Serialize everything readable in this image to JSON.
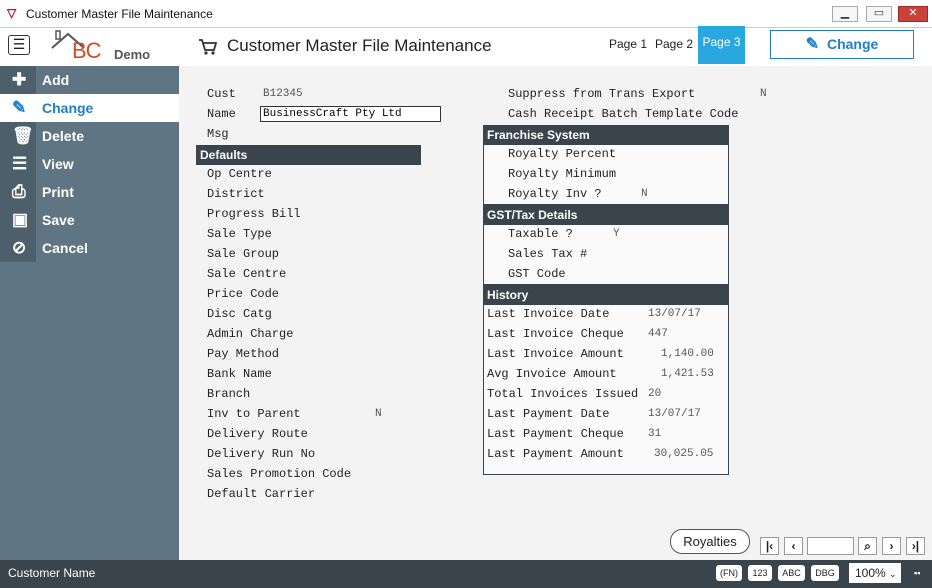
{
  "window": {
    "title": "Customer Master File Maintenance"
  },
  "header": {
    "logo_text": "BC",
    "logo_demo": "Demo",
    "page_title": "Customer Master File Maintenance",
    "tabs": [
      "Page 1",
      "Page 2",
      "Page 3"
    ],
    "active_tab": "Page 3",
    "mode_button": "Change"
  },
  "sidebar": {
    "items": [
      {
        "label": "Add",
        "icon": "plus-icon"
      },
      {
        "label": "Change",
        "icon": "pencil-icon"
      },
      {
        "label": "Delete",
        "icon": "trash-icon"
      },
      {
        "label": "View",
        "icon": "list-icon"
      },
      {
        "label": "Print",
        "icon": "printer-icon"
      },
      {
        "label": "Save",
        "icon": "floppy-icon"
      },
      {
        "label": "Cancel",
        "icon": "cancel-icon"
      }
    ],
    "active": "Change"
  },
  "form": {
    "cust_label": "Cust",
    "cust_value": "B12345",
    "name_label": "Name",
    "name_value": "BusinessCraft Pty Ltd",
    "msg_label": "Msg",
    "defaults_title": "Defaults",
    "defaults": [
      {
        "label": "Op Centre",
        "value": ""
      },
      {
        "label": "District",
        "value": ""
      },
      {
        "label": "Progress Bill",
        "value": ""
      },
      {
        "label": "Sale Type",
        "value": ""
      },
      {
        "label": "Sale Group",
        "value": ""
      },
      {
        "label": "Sale Centre",
        "value": ""
      },
      {
        "label": "Price Code",
        "value": ""
      },
      {
        "label": "Disc Catg",
        "value": ""
      },
      {
        "label": "Admin Charge",
        "value": ""
      },
      {
        "label": "Pay Method",
        "value": ""
      },
      {
        "label": "Bank Name",
        "value": ""
      },
      {
        "label": "Branch",
        "value": ""
      },
      {
        "label": "Inv to Parent",
        "value": "N"
      },
      {
        "label": "Delivery Route",
        "value": ""
      },
      {
        "label": "Delivery Run No",
        "value": ""
      },
      {
        "label": "Sales Promotion Code",
        "value": ""
      },
      {
        "label": "Default Carrier",
        "value": ""
      }
    ],
    "suppress_label": "Suppress from Trans Export",
    "suppress_value": "N",
    "cash_receipt_label": "Cash Receipt Batch Template Code",
    "franchise_title": "Franchise System",
    "franchise": [
      {
        "label": "Royalty Percent",
        "value": ""
      },
      {
        "label": "Royalty Minimum",
        "value": ""
      },
      {
        "label": "Royalty Inv ?",
        "value": "N"
      }
    ],
    "gst_title": "GST/Tax Details",
    "gst": [
      {
        "label": "Taxable ?",
        "value": "Y"
      },
      {
        "label": "Sales Tax #",
        "value": ""
      },
      {
        "label": "GST Code",
        "value": ""
      }
    ],
    "history_title": "History",
    "history": [
      {
        "label": "Last Invoice Date",
        "value": "13/07/17"
      },
      {
        "label": "Last Invoice Cheque",
        "value": "447"
      },
      {
        "label": "Last Invoice Amount",
        "value": "1,140.00"
      },
      {
        "label": "Avg  Invoice Amount",
        "value": "1,421.53"
      },
      {
        "label": "Total Invoices Issued",
        "value": "20"
      },
      {
        "label": "Last Payment Date",
        "value": "13/07/17"
      },
      {
        "label": "Last Payment Cheque",
        "value": "31"
      },
      {
        "label": "Last Payment Amount",
        "value": "30,025.05"
      }
    ]
  },
  "footer": {
    "royalties_button": "Royalties",
    "nav": {
      "first": "first-page-icon",
      "prev": "prev-page-icon",
      "search": "search-icon",
      "next": "next-page-icon",
      "last": "last-page-icon"
    },
    "status_label": "Customer Name",
    "fn_button": "(FN)",
    "num_button": "123",
    "abc_button": "ABC",
    "dbg_button": "DBG",
    "zoom": "100%"
  },
  "colors": {
    "accent": "#29a8e0",
    "sidebar": "#5f7583",
    "section": "#3a444c",
    "close": "#c8413a"
  }
}
